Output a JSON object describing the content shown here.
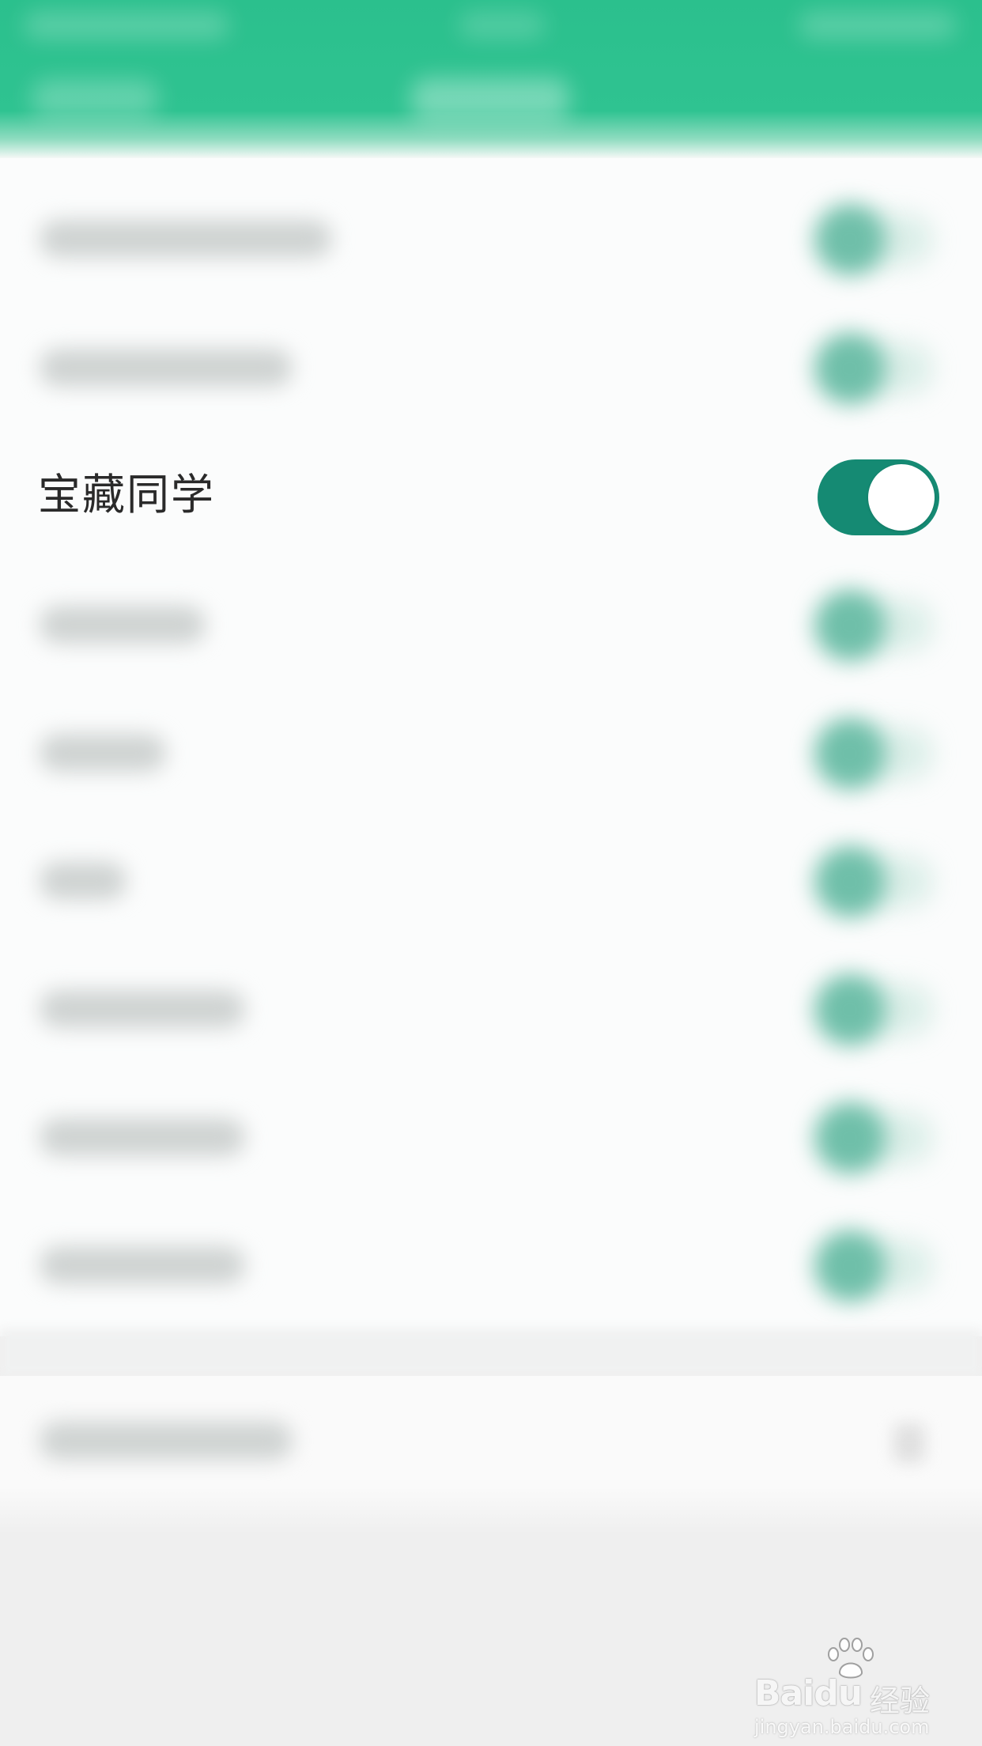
{
  "colors": {
    "header": "#2bc08d",
    "switch_on": "#158a73",
    "switch_knob": "#ffffff",
    "list_bg": "#fbfcfc",
    "page_bg": "#efefef"
  },
  "focused_setting": {
    "label": "宝藏同学",
    "toggle_state": "on"
  },
  "watermark": {
    "brand": "Baidu",
    "brand_cn": "经验",
    "url": "jingyan.baidu.com"
  }
}
